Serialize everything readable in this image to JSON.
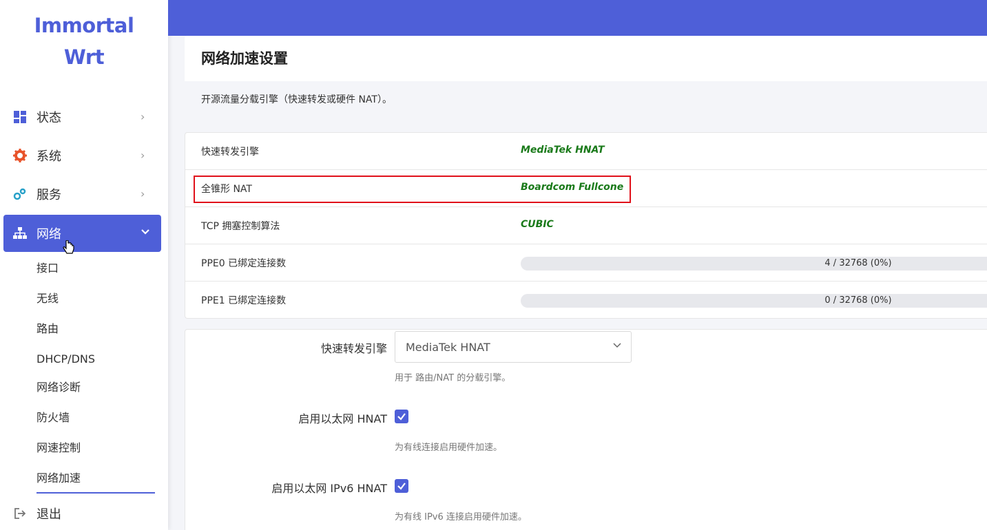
{
  "logo": {
    "line1": "Immortal",
    "line2": "Wrt"
  },
  "sidebar": {
    "items": [
      {
        "label": "状态",
        "icon": "dashboard-icon"
      },
      {
        "label": "系统",
        "icon": "gear-icon"
      },
      {
        "label": "服务",
        "icon": "cogs-icon"
      },
      {
        "label": "网络",
        "icon": "network-icon"
      }
    ],
    "subitems": [
      "接口",
      "无线",
      "路由",
      "DHCP/DNS",
      "网络诊断",
      "防火墙",
      "网速控制",
      "网络加速"
    ],
    "logout": "退出"
  },
  "page": {
    "title": "网络加速设置",
    "description": "开源流量分载引擎（快速转发或硬件 NAT）。"
  },
  "status": [
    {
      "label": "快速转发引擎",
      "value": "MediaTek HNAT"
    },
    {
      "label": "全锥形 NAT",
      "value": "Boardcom Fullcone"
    },
    {
      "label": "TCP 拥塞控制算法",
      "value": "CUBIC"
    },
    {
      "label": "PPE0 已绑定连接数",
      "bar_text": "4 / 32768 (0%)",
      "fill_fraction": 0.0
    },
    {
      "label": "PPE1 已绑定连接数",
      "bar_text": "0 / 32768 (0%)",
      "fill_fraction": 0.0
    }
  ],
  "form": {
    "engine_label": "快速转发引擎",
    "engine_value": "MediaTek HNAT",
    "engine_help": "用于 路由/NAT 的分载引擎。",
    "eth_hnat_label": "启用以太网 HNAT",
    "eth_hnat_checked": true,
    "eth_hnat_help": "为有线连接启用硬件加速。",
    "eth_ipv6_label": "启用以太网 IPv6 HNAT",
    "eth_ipv6_checked": true,
    "eth_ipv6_help": "为有线 IPv6 连接启用硬件加速。"
  },
  "colors": {
    "accent": "#4e5fd8",
    "value_green": "#1a7a1a",
    "highlight_red": "#e0101a"
  }
}
